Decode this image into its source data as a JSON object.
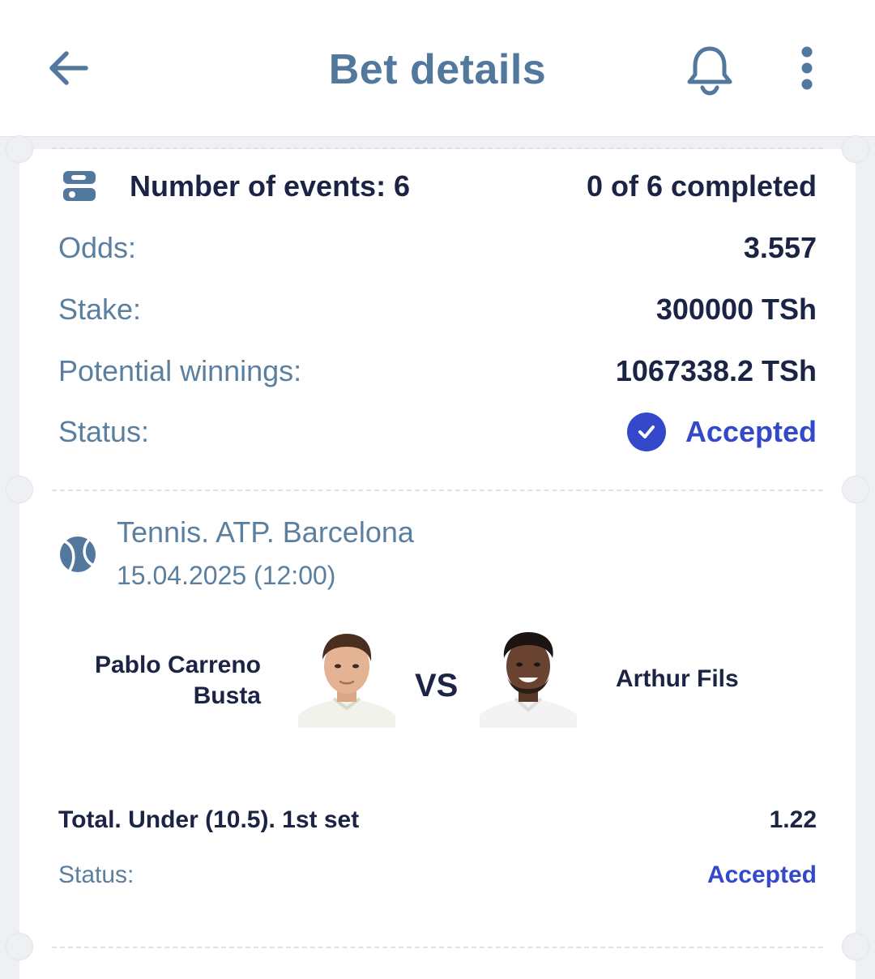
{
  "header": {
    "title": "Bet details",
    "back_icon": "arrow-left-icon",
    "bell_icon": "bell-icon",
    "more_icon": "more-vertical-icon",
    "accent_color": "#52789e"
  },
  "summary": {
    "events_icon": "list-toggle-icon",
    "events_label": "Number of events: 6",
    "completed_label": "0 of 6 completed",
    "rows": [
      {
        "label": "Odds:",
        "value": "3.557"
      },
      {
        "label": "Stake:",
        "value": "300000 TSh"
      },
      {
        "label": "Potential winnings:",
        "value": "1067338.2 TSh"
      }
    ],
    "status_label": "Status:",
    "status_value": "Accepted",
    "status_icon": "check-circle-icon",
    "status_color": "#3349c9"
  },
  "event": {
    "sport_icon": "tennis-ball-icon",
    "title": "Tennis. ATP. Barcelona",
    "date": "15.04.2025 (12:00)",
    "player_left_line1": "Pablo Carreno",
    "player_left_line2": "Busta",
    "vs": "VS",
    "player_right": "Arthur Fils",
    "market": "Total. Under (10.5). 1st set",
    "market_odds": "1.22",
    "status_label": "Status:",
    "status_value": "Accepted"
  }
}
